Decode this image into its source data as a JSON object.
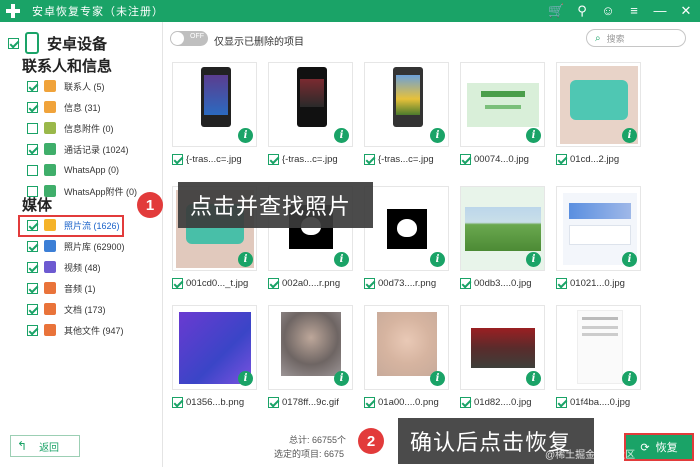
{
  "app": {
    "title": "安卓恢复专家（未注册）",
    "controls": [
      "cart-icon",
      "key-icon",
      "person-icon",
      "menu-icon",
      "minimize-icon",
      "close-icon"
    ]
  },
  "sidebar": {
    "device_label": "安卓设备",
    "contacts_section": "联系人和信息",
    "contacts_items": [
      {
        "label": "联系人 (5)",
        "icon": "contact-icon",
        "color": "#f0a33b",
        "checked": true
      },
      {
        "label": "信息 (31)",
        "icon": "message-icon",
        "color": "#f0a33b",
        "checked": true
      },
      {
        "label": "信息附件 (0)",
        "icon": "attachment-icon",
        "color": "#9ab84a",
        "checked": false
      },
      {
        "label": "通话记录 (1024)",
        "icon": "phone-icon",
        "color": "#3fae6a",
        "checked": true
      },
      {
        "label": "WhatsApp (0)",
        "icon": "whatsapp-icon",
        "color": "#3fae6a",
        "checked": false
      },
      {
        "label": "WhatsApp附件 (0)",
        "icon": "whatsapp-attachment-icon",
        "color": "#3fae6a",
        "checked": false
      }
    ],
    "media_section": "媒体",
    "media_items": [
      {
        "label": "照片流 (1626)",
        "icon": "star-icon",
        "color": "#f5b32a",
        "checked": true,
        "selected": true
      },
      {
        "label": "照片库 (62900)",
        "icon": "gallery-icon",
        "color": "#3c7fd6",
        "checked": true
      },
      {
        "label": "视频 (48)",
        "icon": "video-icon",
        "color": "#6d5ad1",
        "checked": true
      },
      {
        "label": "音频 (1)",
        "icon": "audio-icon",
        "color": "#e9733a",
        "checked": true
      },
      {
        "label": "文档 (173)",
        "icon": "document-icon",
        "color": "#e9733a",
        "checked": true
      },
      {
        "label": "其他文件 (947)",
        "icon": "folder-icon",
        "color": "#e9733a",
        "checked": true
      }
    ],
    "back_label": "返回"
  },
  "toolbar": {
    "toggle_label": "OFF",
    "show_deleted_label": "仅显示已删除的项目",
    "search_placeholder": "搜索"
  },
  "thumbnails": [
    {
      "name": "{-tras...c=.jpg",
      "kind": "phone-purple"
    },
    {
      "name": "{-tras...c=.jpg",
      "kind": "phone-dark"
    },
    {
      "name": "{-tras...c=.jpg",
      "kind": "phone-sunflower"
    },
    {
      "name": "00074...0.jpg",
      "kind": "green-doc"
    },
    {
      "name": "01cd...2.jpg",
      "kind": "teal-food"
    },
    {
      "name": "001cd0..._t.jpg",
      "kind": "teal-food-2"
    },
    {
      "name": "002a0....r.png",
      "kind": "black-cat"
    },
    {
      "name": "00d73....r.png",
      "kind": "black-cat-2"
    },
    {
      "name": "00db3....0.jpg",
      "kind": "grass"
    },
    {
      "name": "01021...0.jpg",
      "kind": "app-screen"
    },
    {
      "name": "01356...b.png",
      "kind": "purple"
    },
    {
      "name": "0178ff...9c.gif",
      "kind": "blur-face"
    },
    {
      "name": "01a00....0.png",
      "kind": "blur-face-2"
    },
    {
      "name": "01d82....0.jpg",
      "kind": "red-scene"
    },
    {
      "name": "01f4ba....0.jpg",
      "kind": "text-doc"
    }
  ],
  "callouts": {
    "step1_number": "1",
    "step1_text": "点击并查找照片",
    "step2_number": "2",
    "step2_text": "确认后点击恢复"
  },
  "footer": {
    "total_label": "总计: 66755个",
    "selected_label": "选定的项目: 6675"
  },
  "recover_label": "恢复",
  "watermark": "@稀土掘金技术社区",
  "colors": {
    "accent": "#1aa367",
    "highlight": "#e23b3b"
  }
}
